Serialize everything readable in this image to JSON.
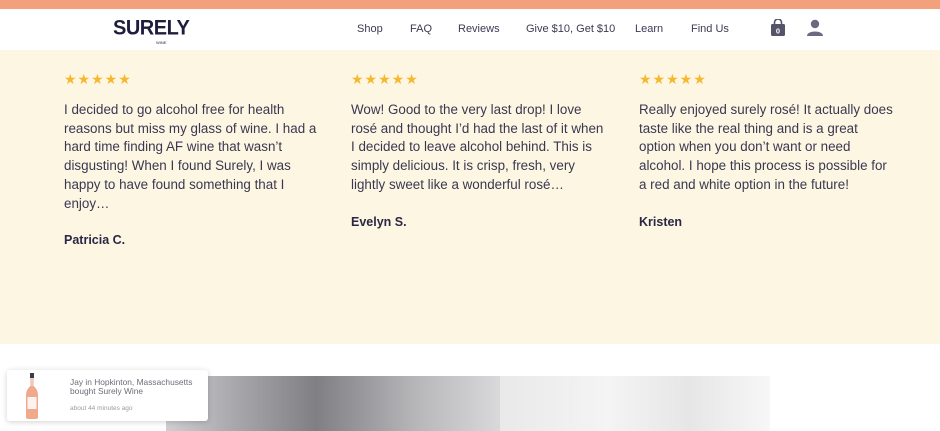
{
  "brand": {
    "logo": "SURELY",
    "logo_sub": "WINE"
  },
  "nav": {
    "items": [
      "Shop",
      "FAQ",
      "Reviews",
      "Give $10, Get $10",
      "Learn",
      "Find Us"
    ],
    "cart_count": "0"
  },
  "reviews": [
    {
      "rating": 5,
      "stars": "★★★★★",
      "text": "I decided to go alcohol free for health reasons but miss my glass of wine. I had a hard time finding AF wine that wasn’t disgusting! When I found Surely, I was happy to have found something that I enjoy…",
      "author": "Patricia C."
    },
    {
      "rating": 5,
      "stars": "★★★★★",
      "text": "Wow! Good to the very last drop! I love rosé and thought I’d had the last of it when I decided to leave alcohol behind. This is simply delicious. It is crisp, fresh, very lightly sweet like a wonderful rosé…",
      "author": "Evelyn S."
    },
    {
      "rating": 5,
      "stars": "★★★★★",
      "text": "Really enjoyed surely rosé! It actually does taste like the real thing and is a great option when you don’t want or need alcohol. I hope this process is possible for a red and white option in the future!",
      "author": "Kristen"
    }
  ],
  "notification": {
    "message": "Jay in Hopkinton, Massachusetts bought Surely Wine",
    "time": "about 44 minutes ago"
  },
  "colors": {
    "accent": "#f3a17c",
    "stars": "#f5b82e",
    "reviews_bg": "#fdf6e3",
    "brand": "#1f1d3d"
  },
  "icons": [
    "shopping-bag-icon",
    "user-icon",
    "star-icon",
    "wine-bottle-icon"
  ]
}
